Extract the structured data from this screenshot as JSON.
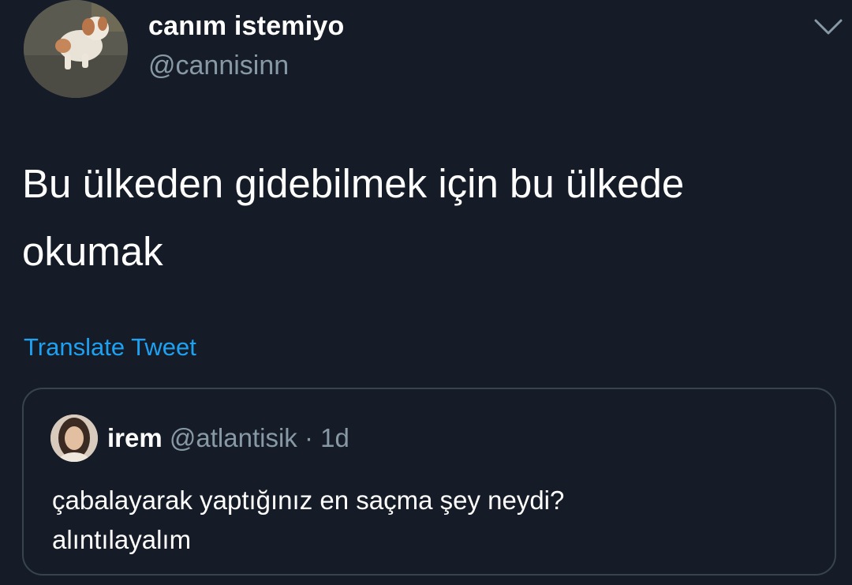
{
  "tweet": {
    "display_name": "canım istemiyo",
    "handle": "@cannisinn",
    "text_line1": "Bu ülkeden gidebilmek için bu ülkede",
    "text_line2": "okumak",
    "translate_label": "Translate Tweet",
    "menu_icon": "chevron-down-icon"
  },
  "quote": {
    "display_name": "irem",
    "handle": "@atlantisik",
    "separator": "·",
    "time": "1d",
    "text_line1": "çabalayarak yaptığınız en saçma şey neydi?",
    "text_line2": "alıntılayalım"
  },
  "colors": {
    "background": "#151c28",
    "secondary_text": "#8899a6",
    "link": "#1da1f2",
    "border": "#38444d"
  }
}
